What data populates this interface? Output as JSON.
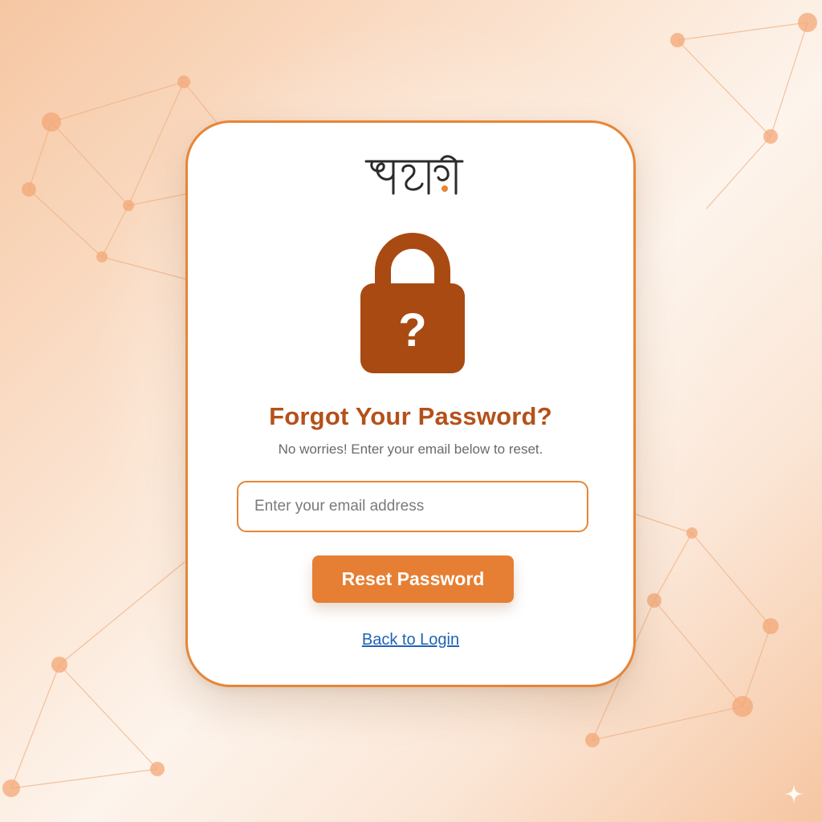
{
  "brand": {
    "logo_text": "सारथी"
  },
  "icons": {
    "lock": "lock-question-icon",
    "lock_symbol": "?",
    "sparkle": "sparkle-icon"
  },
  "form": {
    "title": "Forgot Your Password?",
    "subtitle": "No worries! Enter your email below to reset.",
    "email_placeholder": "Enter your email address",
    "email_value": "",
    "submit_label": "Reset Password",
    "back_link_label": "Back to Login"
  },
  "colors": {
    "accent": "#e58638",
    "title": "#b5501a",
    "lock": "#a94a12",
    "button": "#e67f33",
    "link": "#1f63b5"
  }
}
